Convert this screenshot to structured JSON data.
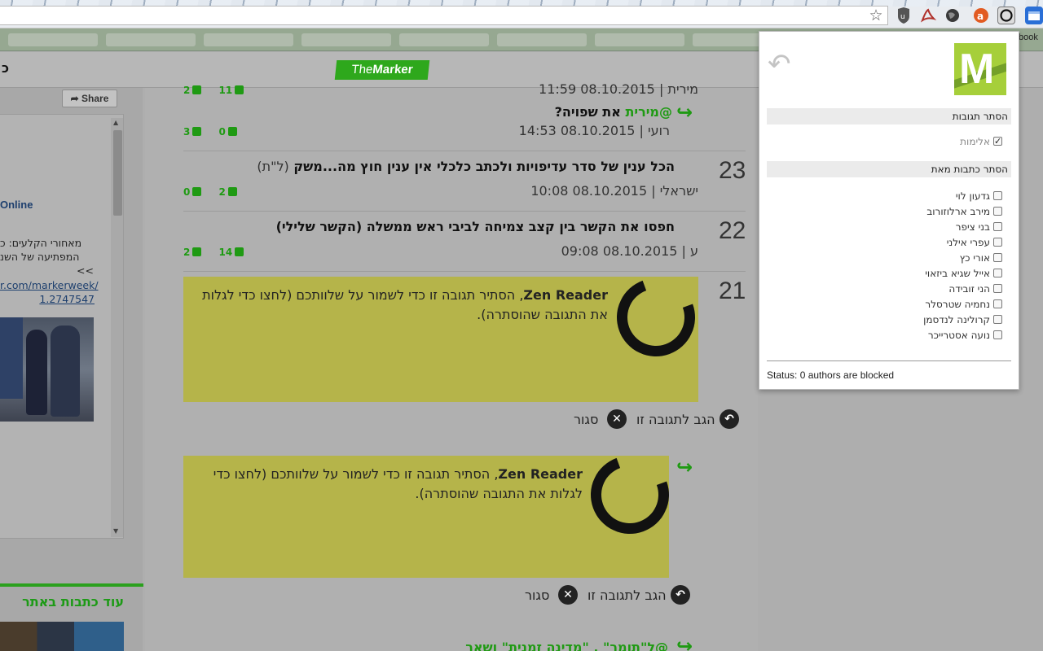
{
  "sidebar": {
    "share_label": "Share",
    "online_label": "Online",
    "post_text_line1": "מאחורי הקלעים: כ",
    "post_text_line2": "המפתיעה של השנ",
    "post_text_line3": ">>",
    "post_link_line1": "r.com/markerweek/",
    "post_link_line2": "1.2747547",
    "more_articles": "עוד כתבות באתר"
  },
  "header": {
    "logo_part1": "The",
    "logo_part2": "Marker",
    "left_char": "כ"
  },
  "comments": [
    {
      "meta": "מירית | 08.10.2015 11:59",
      "likes": "11",
      "dislikes": "2"
    },
    {
      "mention": "@מירית",
      "title": "את שפויה?",
      "meta": "רועי | 08.10.2015 14:53",
      "likes": "0",
      "dislikes": "3"
    },
    {
      "number": "23",
      "title": "הכל ענין של סדר עדיפויות ולכתב כלכלי אין ענין חוץ מה...משק",
      "title_suffix": "(ל\"ת)",
      "meta": "ישראלי | 08.10.2015 10:08",
      "likes": "2",
      "dislikes": "0"
    },
    {
      "number": "22",
      "title": "חפסו את הקשר בין קצב צמיחה לביבי ראש ממשלה (הקשר שלילי)",
      "meta": "ע | 08.10.2015 09:08",
      "likes": "14",
      "dislikes": "2"
    }
  ],
  "hidden_comments": [
    {
      "number": "21",
      "app_name": "Zen Reader",
      "text": ", הסתיר תגובה זו כדי לשמור על שלוותכם (לחצו כדי לגלות את התגובה שהוסתרה).",
      "reply_label": "הגב לתגובה זו",
      "close_label": "סגור"
    },
    {
      "app_name": "Zen Reader",
      "text": ", הסתיר תגובה זו כדי לשמור על שלוותכם (לחצו כדי לגלות את התגובה שהוסתרה).",
      "reply_label": "הגב לתגובה זו",
      "close_label": "סגור"
    }
  ],
  "next_comment_title": "@ל\"תומר\" , \"מדינה זמנית\" ושאר",
  "popup": {
    "hide_comments_header": "הסתר תגובות",
    "hide_comments_option": "אלימות",
    "hide_authors_header": "הסתר כתבות מאת",
    "authors": [
      "גדעון לוי",
      "מירב ארלוזורוב",
      "בני ציפר",
      "עפרי אילני",
      "אורי כץ",
      "אייל שגיא ביזאוי",
      "הני זובידה",
      "נחמיה שטרסלר",
      "קרולינה לנדסמן",
      "נועה אסטרייכר"
    ],
    "status": "Status: 0 authors are blocked"
  },
  "browser": {
    "bookmark_partial": "book"
  },
  "colors": {
    "accent_green": "#1f9a13",
    "hidden_box": "#b5b44a",
    "popup_logo": "#a6cf3a"
  }
}
